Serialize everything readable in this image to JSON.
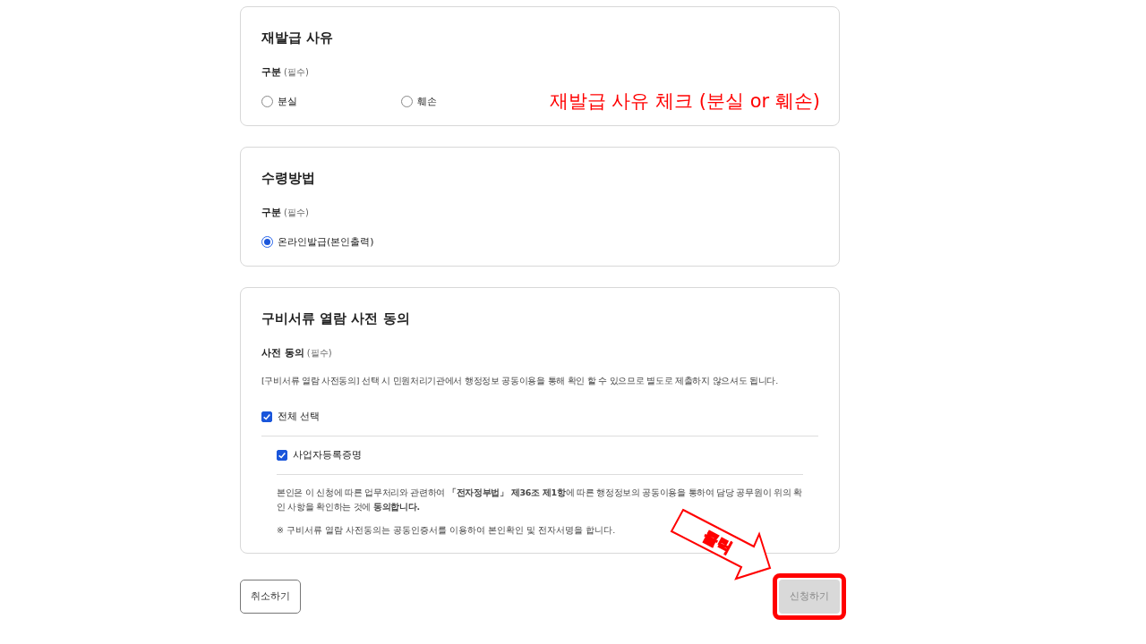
{
  "sections": [
    {
      "title": "재발급 사유",
      "field": {
        "label": "구분",
        "required": "(필수)"
      },
      "radios": [
        {
          "label": "분실",
          "selected": false
        },
        {
          "label": "훼손",
          "selected": false
        }
      ],
      "annotation": "재발급 사유 체크 (분실 or 훼손)"
    },
    {
      "title": "수령방법",
      "field": {
        "label": "구분",
        "required": "(필수)"
      },
      "radios": [
        {
          "label": "온라인발급(본인출력)",
          "selected": true
        }
      ]
    },
    {
      "title": "구비서류 열람 사전 동의",
      "field": {
        "label": "사전 동의",
        "required": "(필수)"
      },
      "description": "[구비서류 열람 사전동의] 선택 시 민원처리기관에서 행정정보 공동이용을 통해 확인 할 수 있으므로 별도로 제출하지 않으셔도 됩니다.",
      "select_all": {
        "label": "전체 선택",
        "checked": true
      },
      "items": [
        {
          "label": "사업자등록증명",
          "checked": true
        }
      ],
      "consent": "본인은 이 신청에 따른 업무처리와 관련하여 **「전자정부법」 제36조 제1항**에 따른 행정정보의 공동이용을 통하여 담당 공무원이 위의 확인 사항을 확인하는 것에 **동의합니다.**",
      "note": "※ 구비서류 열람 사전동의는 공동인증서를 이용하여 본인확인 및 전자서명을 합니다."
    }
  ],
  "buttons": {
    "cancel": "취소하기",
    "submit": "신청하기"
  },
  "callout": "클릭"
}
